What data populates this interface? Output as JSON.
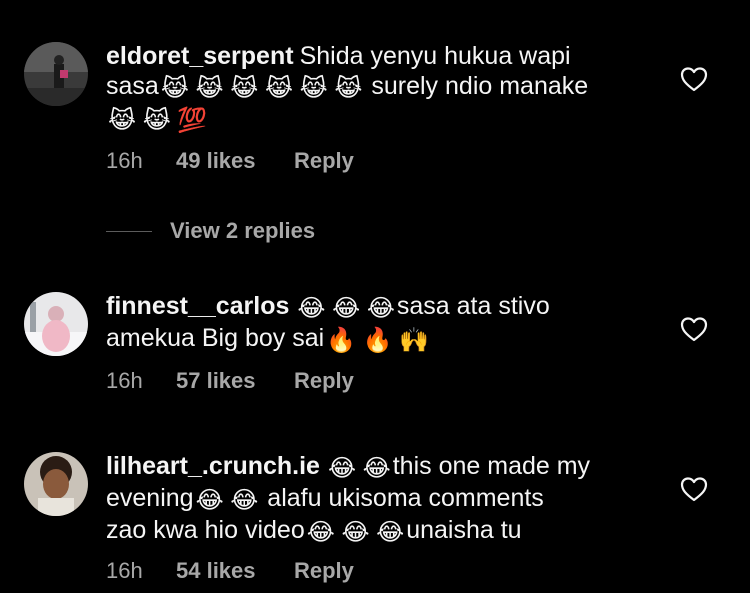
{
  "comments": [
    {
      "username": "eldoret_serpent",
      "text_a": "Shida yenyu hukua wapi",
      "text_b": "sasa",
      "emoji_group_1": "😹 😹 😹 😹 😹 😹",
      "text_c": "surely ndio manake",
      "emoji_group_2": "😹 😹 💯",
      "time": "16h",
      "likes": "49 likes",
      "reply": "Reply"
    },
    {
      "username": "finnest__carlos",
      "emoji_group_1": "😂 😂 😂",
      "text_a": "sasa ata stivo",
      "text_b": "amekua Big boy sai",
      "emoji_group_2": "🔥 🔥 🙌",
      "time": "16h",
      "likes": "57 likes",
      "reply": "Reply"
    },
    {
      "username": "lilheart_.crunch.ie",
      "emoji_group_1": "😂 😂",
      "text_a": "this one made my",
      "text_b": "evening",
      "emoji_group_2": "😂 😂",
      "text_c": "alafu ukisoma comments",
      "text_d": "zao  kwa hio video",
      "emoji_group_3": "😂 😂 😂",
      "text_e": "unaisha tu",
      "time": "16h",
      "likes": "54 likes",
      "reply": "Reply"
    }
  ],
  "view_replies": "View 2 replies",
  "colors": {
    "background": "#000000",
    "text": "#f5f5f5",
    "muted": "#a8a8a8"
  },
  "icons": [
    "heart-outline-icon"
  ]
}
